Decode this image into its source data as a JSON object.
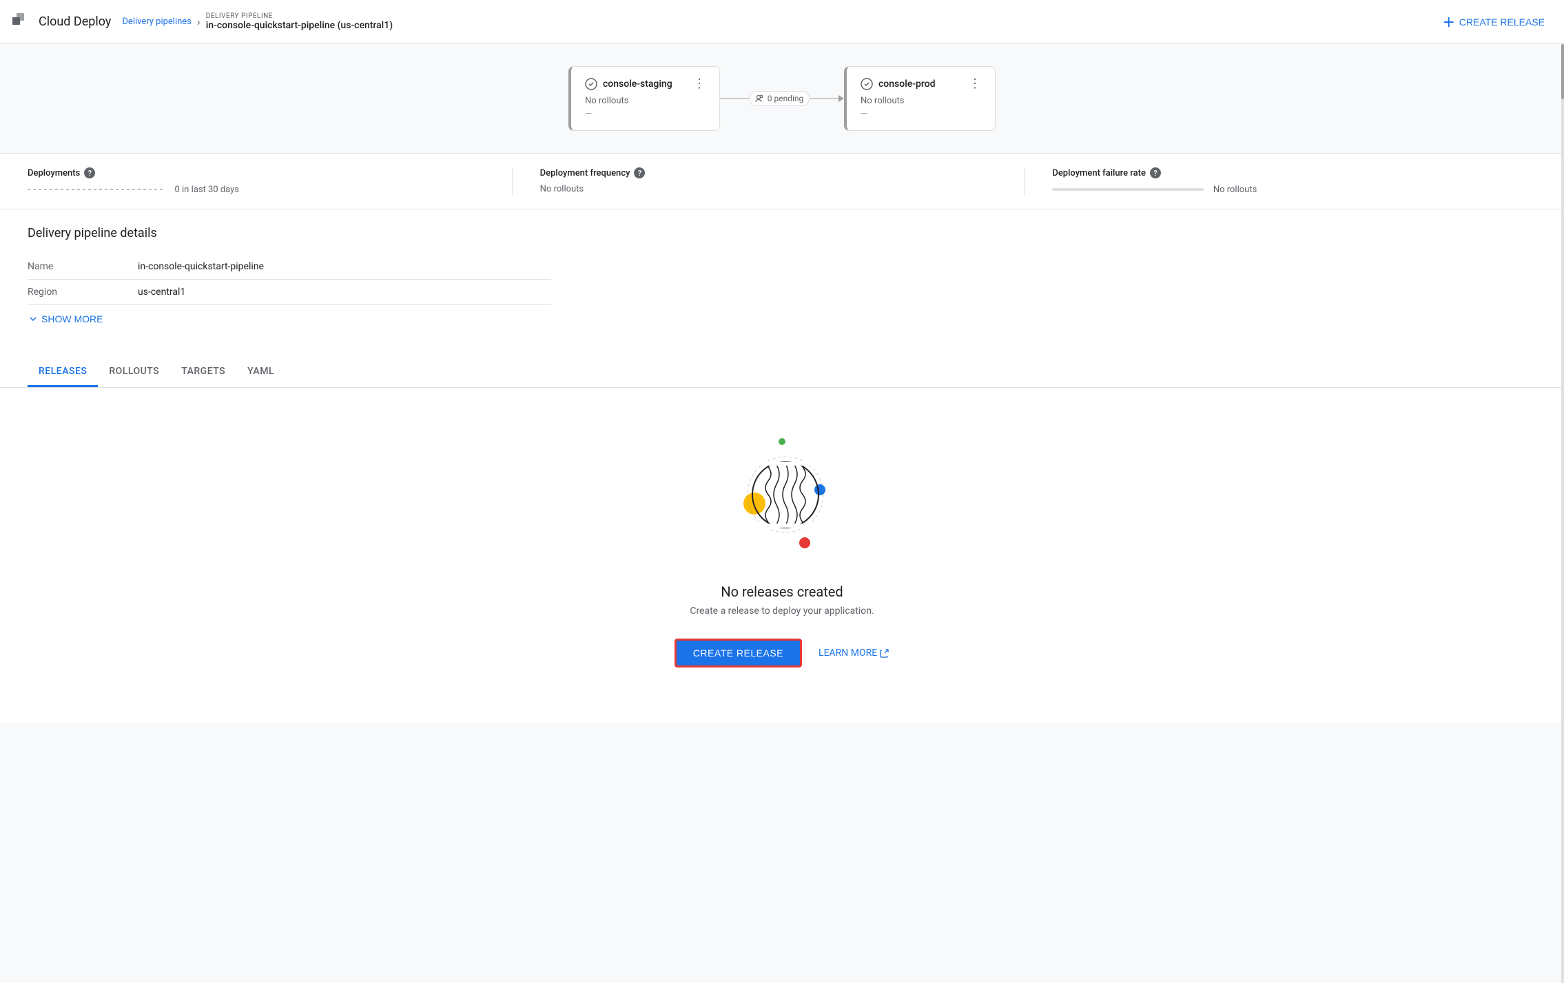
{
  "app": {
    "name": "Cloud Deploy"
  },
  "header": {
    "breadcrumb_link": "Delivery pipelines",
    "pipeline_label": "DELIVERY PIPELINE",
    "pipeline_name": "in-console-quickstart-pipeline (us-central1)",
    "create_release_label": "CREATE RELEASE"
  },
  "pipeline": {
    "stages": [
      {
        "id": "staging",
        "name": "console-staging",
        "rollouts": "No rollouts",
        "dash": "—"
      },
      {
        "id": "prod",
        "name": "console-prod",
        "rollouts": "No rollouts",
        "dash": "—"
      }
    ],
    "connector": {
      "pending_count": "0 pending"
    }
  },
  "metrics": {
    "deployments": {
      "label": "Deployments",
      "value": "0 in last 30 days"
    },
    "frequency": {
      "label": "Deployment frequency",
      "value": "No rollouts"
    },
    "failure_rate": {
      "label": "Deployment failure rate",
      "value": "No rollouts"
    }
  },
  "details": {
    "section_title": "Delivery pipeline details",
    "fields": [
      {
        "key": "Name",
        "value": "in-console-quickstart-pipeline"
      },
      {
        "key": "Region",
        "value": "us-central1"
      }
    ],
    "show_more_label": "SHOW MORE"
  },
  "tabs": [
    {
      "id": "releases",
      "label": "RELEASES",
      "active": true
    },
    {
      "id": "rollouts",
      "label": "ROLLOUTS",
      "active": false
    },
    {
      "id": "targets",
      "label": "TARGETS",
      "active": false
    },
    {
      "id": "yaml",
      "label": "YAML",
      "active": false
    }
  ],
  "empty_state": {
    "title": "No releases created",
    "subtitle": "Create a release to deploy your application.",
    "create_label": "CREATE RELEASE",
    "learn_more_label": "LEARN MORE"
  }
}
